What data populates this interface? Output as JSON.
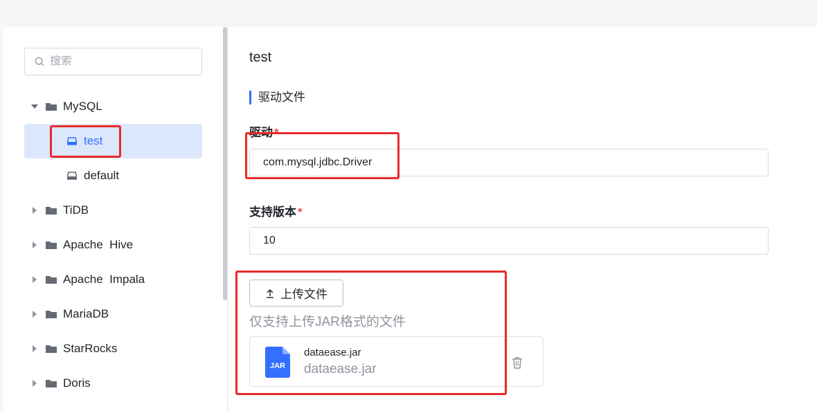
{
  "search": {
    "placeholder": "搜索"
  },
  "tree": {
    "groups": [
      {
        "label": "MySQL",
        "expanded": true,
        "children": [
          {
            "label": "test",
            "selected": true
          },
          {
            "label": "default",
            "selected": false
          }
        ]
      },
      {
        "label": "TiDB"
      },
      {
        "label": "Apache  Hive"
      },
      {
        "label": "Apache  Impala"
      },
      {
        "label": "MariaDB"
      },
      {
        "label": "StarRocks"
      },
      {
        "label": "Doris"
      }
    ]
  },
  "main": {
    "title": "test",
    "section_title": "驱动文件",
    "driver": {
      "label": "驱动",
      "value": "com.mysql.jdbc.Driver"
    },
    "version": {
      "label": "支持版本",
      "value": "10"
    },
    "upload": {
      "button_label": "上传文件",
      "hint": "仅支持上传JAR格式的文件"
    },
    "file": {
      "name": "dataease.jar",
      "subtitle": "dataease.jar",
      "icon_text": "JAR"
    }
  },
  "colors": {
    "accent": "#3370ff",
    "required": "#f54a45",
    "highlight": "#e82a2a",
    "selected_bg": "#dde7fc"
  }
}
